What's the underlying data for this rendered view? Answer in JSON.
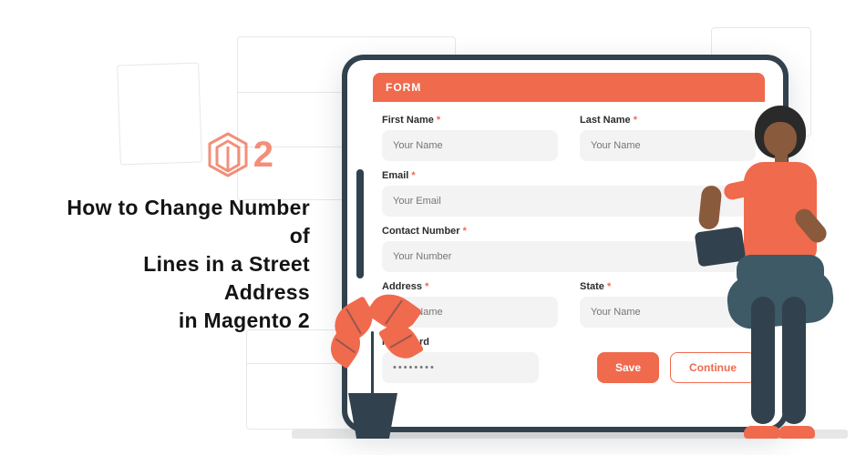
{
  "colors": {
    "accent": "#f06a4d",
    "frame": "#31414d",
    "input_bg": "#f3f3f3"
  },
  "logo": {
    "number": "2"
  },
  "title": {
    "line1": "How to Change Number of",
    "line2": "Lines in a Street Address",
    "line3": "in Magento 2"
  },
  "form": {
    "header": "FORM",
    "first_name": {
      "label": "First Name",
      "placeholder": "Your Name",
      "required": true
    },
    "last_name": {
      "label": "Last Name",
      "placeholder": "Your Name",
      "required": true
    },
    "email": {
      "label": "Email",
      "placeholder": "Your Email",
      "required": true
    },
    "contact_number": {
      "label": "Contact  Number",
      "placeholder": "Your Number",
      "required": true
    },
    "address": {
      "label": "Address",
      "placeholder": "Your Name",
      "required": true
    },
    "state": {
      "label": "State",
      "placeholder": "Your Name",
      "required": true
    },
    "password": {
      "label": "Password",
      "placeholder": "••••••••",
      "required": false
    },
    "save_label": "Save",
    "continue_label": "Continue"
  }
}
